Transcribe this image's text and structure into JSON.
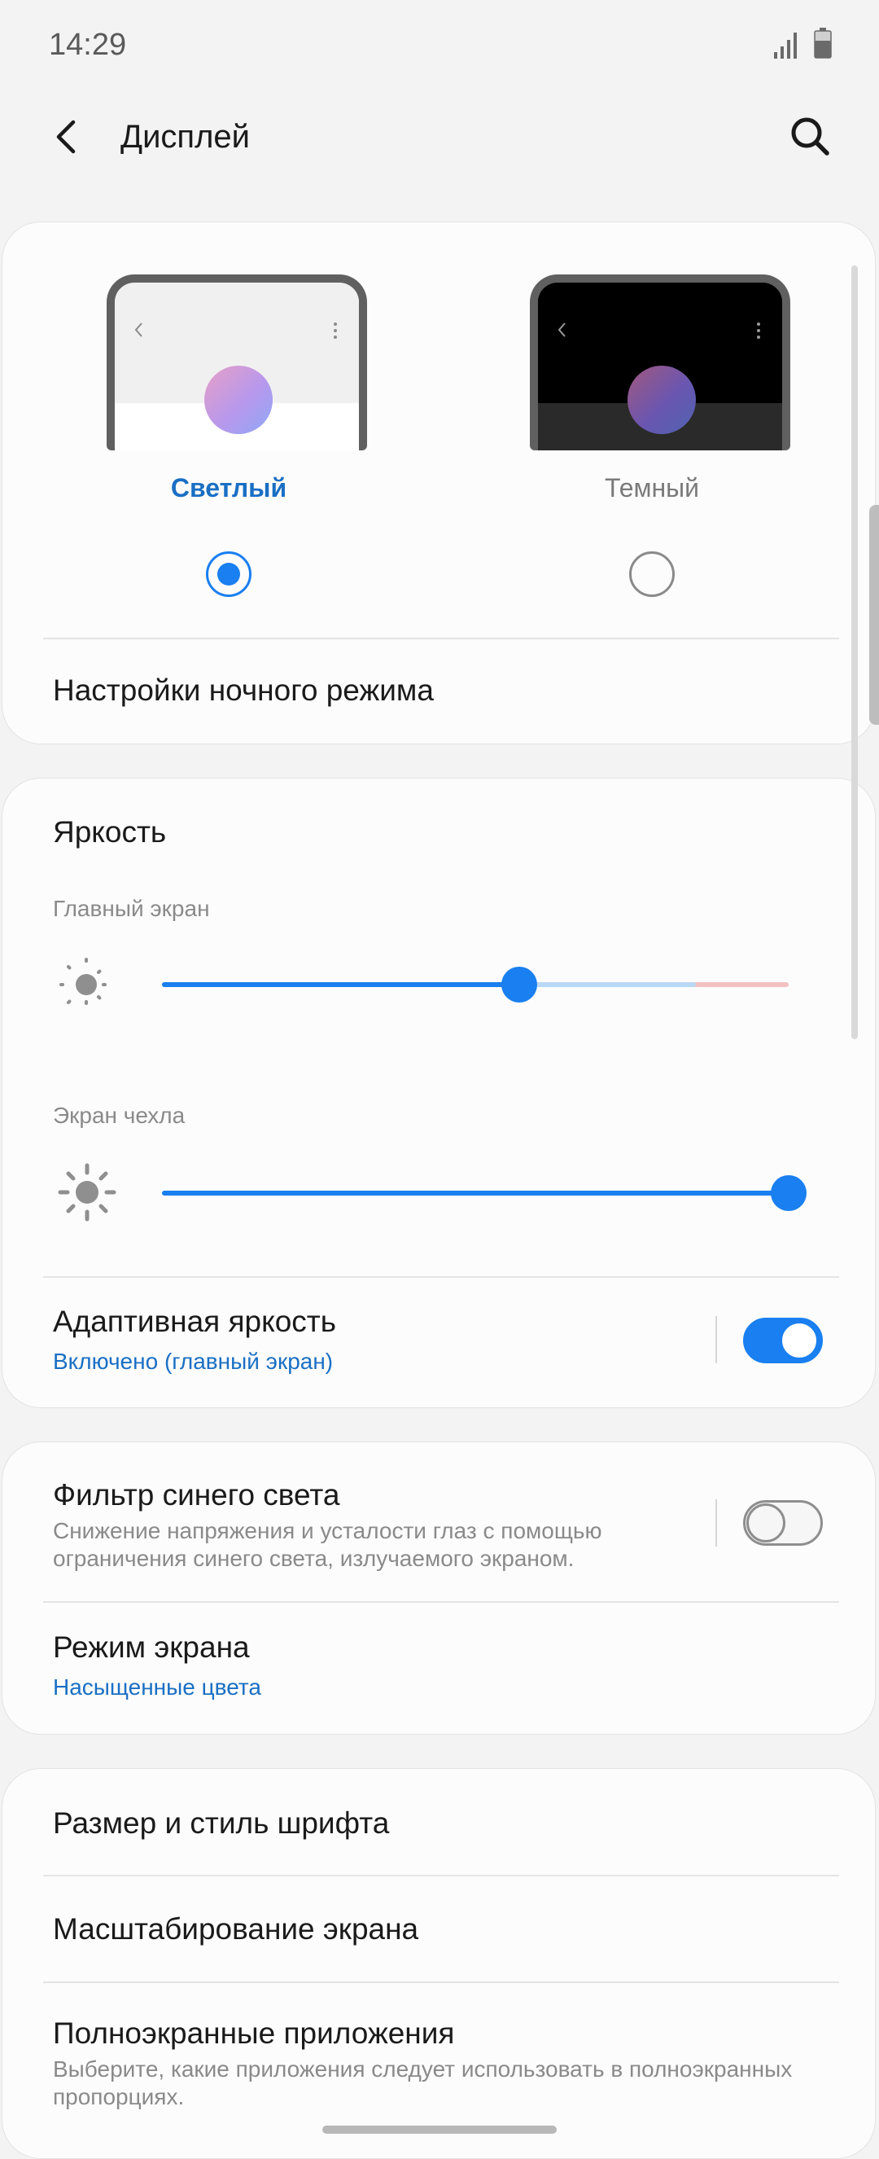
{
  "status": {
    "time": "14:29"
  },
  "header": {
    "title": "Дисплей"
  },
  "theme": {
    "light_label": "Светлый",
    "dark_label": "Темный",
    "selected": "light",
    "night_mode_settings": "Настройки ночного режима"
  },
  "brightness": {
    "title": "Яркость",
    "main_label": "Главный экран",
    "main_level": 0.57,
    "cover_label": "Экран чехла",
    "cover_level": 1.0,
    "adaptive_title": "Адаптивная яркость",
    "adaptive_status": "Включено (главный экран)",
    "adaptive_on": true
  },
  "blue_filter": {
    "title": "Фильтр синего света",
    "description": "Снижение напряжения и усталости глаз с помощью ограничения синего света, излучаемого экраном.",
    "on": false
  },
  "screen_mode": {
    "title": "Режим экрана",
    "value": "Насыщенные цвета"
  },
  "font": {
    "title": "Размер и стиль шрифта"
  },
  "zoom": {
    "title": "Масштабирование экрана"
  },
  "fullscreen": {
    "title": "Полноэкранные приложения",
    "description": "Выберите, какие приложения следует использовать в полноэкранных пропорциях."
  },
  "colors": {
    "accent": "#1a7ff0",
    "accent_text": "#1a6fc4",
    "track_light": "#b9d8f6",
    "track_warn": "#f2c1c1"
  },
  "icons": {
    "back": "chevron-left-icon",
    "search": "magnifier-icon",
    "brightness": "sun-icon"
  }
}
